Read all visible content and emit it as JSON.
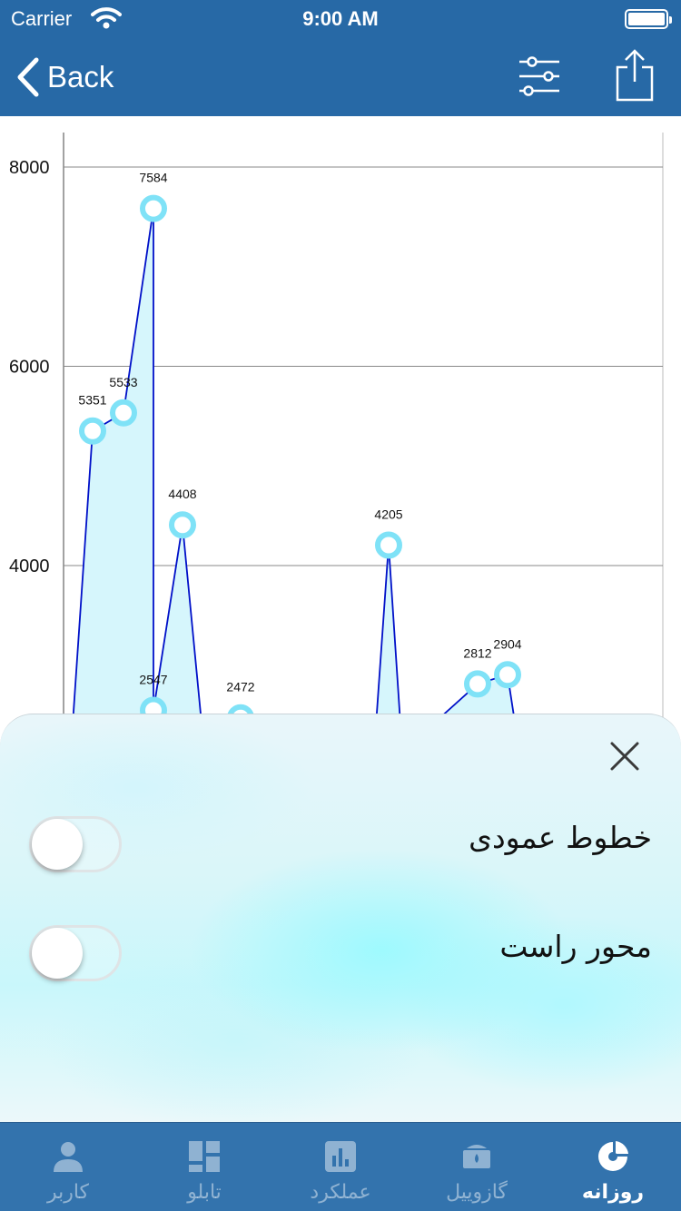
{
  "status_bar": {
    "carrier": "Carrier",
    "time": "9:00 AM"
  },
  "nav": {
    "back_label": "Back",
    "filter_icon": "sliders-icon",
    "share_icon": "share-icon"
  },
  "chart_data": {
    "type": "area",
    "y_ticks": [
      "4000",
      "6000",
      "8000"
    ],
    "ylim": [
      2000,
      8400
    ],
    "grid": "horizontal",
    "line_color": "#0010c8",
    "fill_color": "#d6f6fc",
    "marker_color": "#7fe2f7",
    "points": [
      {
        "label": "",
        "value": 2000
      },
      {
        "label": "5351",
        "value": 5351
      },
      {
        "label": "5533",
        "value": 5533
      },
      {
        "label": "7584",
        "value": 7584
      },
      {
        "label": "2547",
        "value": 2547
      },
      {
        "label": "4408",
        "value": 4408
      },
      {
        "label": "",
        "value": 2000
      },
      {
        "label": "2472",
        "value": 2472
      },
      {
        "label": "",
        "value": 2000
      },
      {
        "label": "4205",
        "value": 4205
      },
      {
        "label": "",
        "value": 2000
      },
      {
        "label": "2812",
        "value": 2812
      },
      {
        "label": "2904",
        "value": 2904
      },
      {
        "label": "",
        "value": 2000
      }
    ]
  },
  "sheet": {
    "close_icon": "close-icon",
    "options": [
      {
        "label": "خطوط عمودی",
        "enabled": false
      },
      {
        "label": "محور راست",
        "enabled": false
      }
    ]
  },
  "tabbar": {
    "tabs": [
      {
        "label": "روزانه",
        "icon": "pie-chart-icon",
        "active": true
      },
      {
        "label": "گازوییل",
        "icon": "fuel-tank-icon",
        "active": false
      },
      {
        "label": "عملکرد",
        "icon": "bar-chart-icon",
        "active": false
      },
      {
        "label": "تابلو",
        "icon": "dashboard-icon",
        "active": false
      },
      {
        "label": "کاربر",
        "icon": "user-icon",
        "active": false
      }
    ]
  }
}
